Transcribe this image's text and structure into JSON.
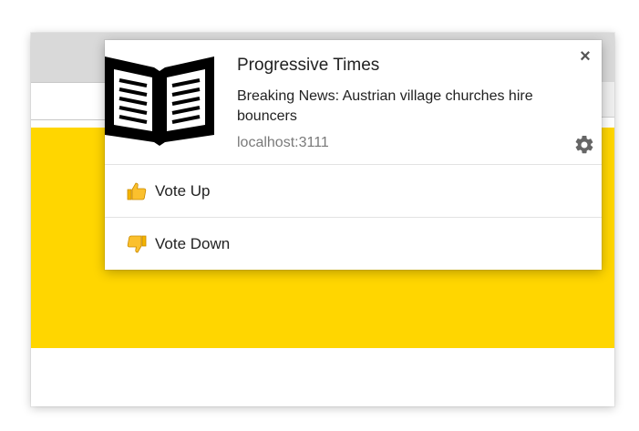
{
  "notification": {
    "title": "Progressive Times",
    "message": "Breaking News: Austrian village churches hire bouncers",
    "origin": "localhost:3111",
    "icon": "open-book-icon",
    "close_icon": "close-icon",
    "settings_icon": "gear-icon",
    "actions": [
      {
        "label": "Vote Up",
        "icon": "thumbs-up-icon"
      },
      {
        "label": "Vote Down",
        "icon": "thumbs-down-icon"
      }
    ]
  },
  "colors": {
    "page_accent": "#ffd600",
    "emoji_yellow": "#f4b400"
  }
}
